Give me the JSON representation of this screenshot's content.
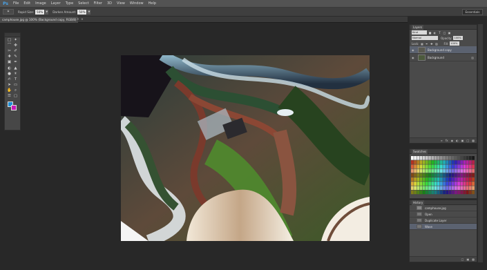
{
  "app": {
    "logo": "Ps"
  },
  "menu": [
    "File",
    "Edit",
    "Image",
    "Layer",
    "Type",
    "Select",
    "Filter",
    "3D",
    "View",
    "Window",
    "Help"
  ],
  "options": {
    "tool_glyph": "✶",
    "field1_label": "Rapid Size:",
    "field1_value": "50%",
    "field2_label": "Darken Amount:",
    "field2_value": "50%",
    "workspace": "Essentials"
  },
  "document": {
    "tab_title": "camphouse.jpg @ 100% (Background copy, RGB/8) *",
    "close_glyph": "×"
  },
  "toolbar": {
    "tools": [
      [
        "□",
        "✦"
      ],
      [
        "⌒",
        "✤"
      ],
      [
        "✂",
        "✐"
      ],
      [
        "✚",
        "✎"
      ],
      [
        "▣",
        "✒"
      ],
      [
        "◐",
        "▲"
      ],
      [
        "●",
        "☀"
      ],
      [
        "✍",
        "T"
      ],
      [
        "➤",
        "▭"
      ],
      [
        "✋",
        "⌕"
      ],
      [
        "☰",
        "▢"
      ]
    ],
    "foreground_color": "#1f8fd6",
    "background_color": "#c71ab6"
  },
  "layers_panel": {
    "tab": "Layers",
    "kind_label": "Kind",
    "blend_mode": "Normal",
    "opacity_label": "Opacity:",
    "opacity_value": "100%",
    "lock_label": "Lock:",
    "fill_label": "Fill:",
    "fill_value": "100%",
    "layers": [
      {
        "name": "Background copy",
        "selected": true
      },
      {
        "name": "Background",
        "selected": false
      }
    ]
  },
  "swatches_panel": {
    "tab": "Swatches"
  },
  "history_panel": {
    "tab": "History",
    "snapshot": "camphouse.jpg",
    "steps": [
      "Open",
      "Duplicate Layer",
      "Wave"
    ]
  }
}
